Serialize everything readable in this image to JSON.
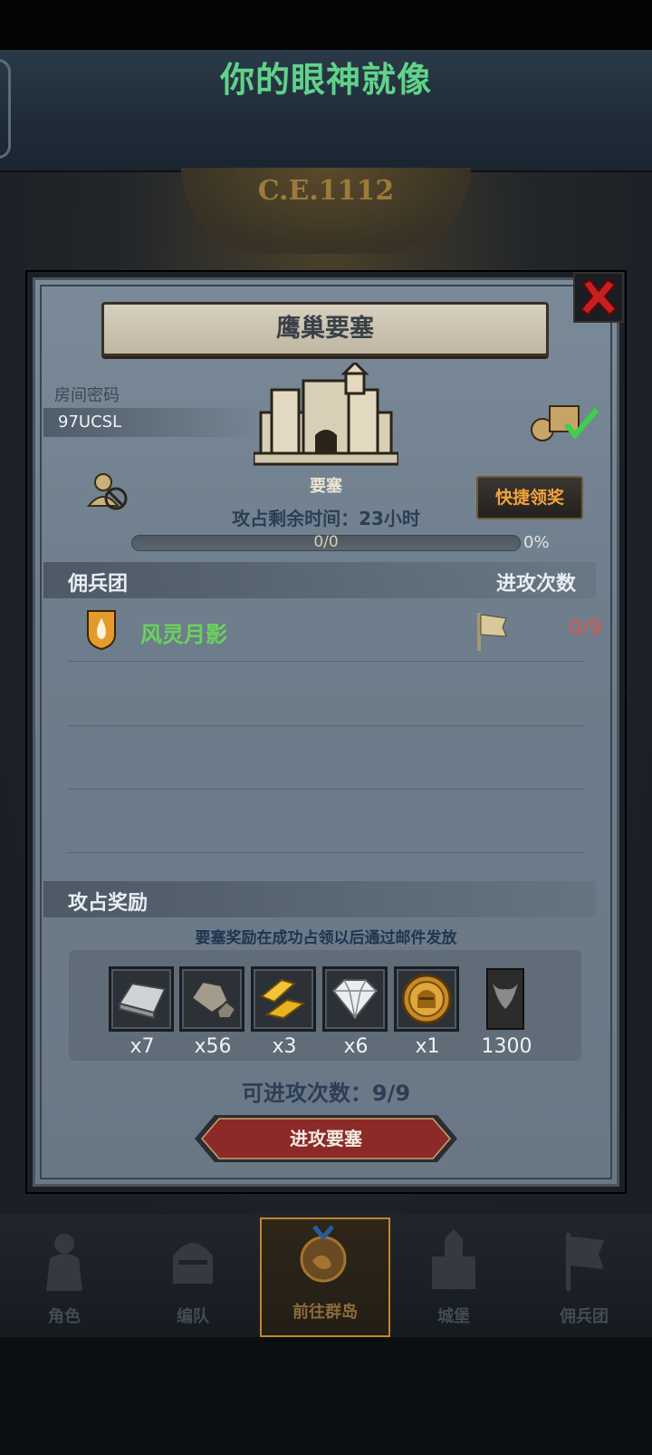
{
  "header": {
    "title": "你的眼神就像"
  },
  "map": {
    "year": "C.E.1112"
  },
  "dialog": {
    "title": "鹰巢要塞",
    "room_label": "房间密码",
    "room_code": "97UCSL",
    "fortress_name": "要塞",
    "timer_text": "攻占剩余时间：23小时",
    "quick_claim_label": "快捷领奖",
    "progress": {
      "text": "0/0",
      "percent_text": "0%",
      "fraction": 0
    },
    "guild_section_label": "佣兵团",
    "attack_count_label": "进攻次数",
    "guilds": [
      {
        "name": "风灵月影",
        "attacks": "0/9"
      }
    ],
    "reward_section_label": "攻占奖励",
    "reward_note": "要塞奖励在成功占领以后通过邮件发放",
    "rewards": [
      {
        "icon": "silver-ingot-icon",
        "qty": "x7"
      },
      {
        "icon": "stone-ore-icon",
        "qty": "x56"
      },
      {
        "icon": "gold-bars-icon",
        "qty": "x3"
      },
      {
        "icon": "diamond-icon",
        "qty": "x6"
      },
      {
        "icon": "knight-coin-icon",
        "qty": "x1"
      },
      {
        "icon": "bull-banner-icon",
        "qty": "1300"
      }
    ],
    "attacks_left": "可进攻次数：9/9",
    "attack_button_label": "进攻要塞"
  },
  "nav": [
    {
      "label": "角色",
      "icon": "knight-icon"
    },
    {
      "label": "编队",
      "icon": "helmet-icon"
    },
    {
      "label": "前往群岛",
      "icon": "island-icon",
      "active": true
    },
    {
      "label": "城堡",
      "icon": "castle-icon"
    },
    {
      "label": "佣兵团",
      "icon": "banner-icon"
    }
  ],
  "colors": {
    "title_green": "#5fd38a",
    "guild_green": "#6ad35b",
    "attack_red": "#e0534f",
    "quick_claim_orange": "#f3a23d",
    "nav_active_border": "#c1862b"
  }
}
